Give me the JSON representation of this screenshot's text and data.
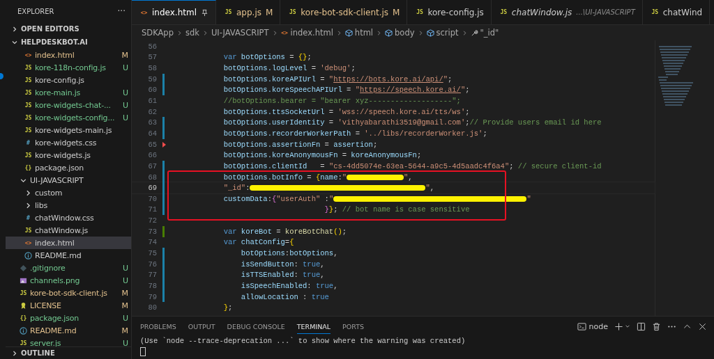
{
  "sidebar": {
    "title": "EXPLORER",
    "more": "···",
    "sections": [
      {
        "label": "OPEN EDITORS",
        "expanded": false
      },
      {
        "label": "HELPDESKBOT.AI",
        "expanded": true
      }
    ],
    "tree": [
      {
        "kind": "scrolled",
        "children": [
          {
            "label": "index.html",
            "kind": "html",
            "icon": "<>",
            "status": "M",
            "selected": false
          },
          {
            "label": "kore-118n-config.js",
            "kind": "js",
            "icon": "JS",
            "status": "U",
            "selected": false
          },
          {
            "label": "kore-config.js",
            "kind": "js",
            "icon": "JS",
            "selected": false
          },
          {
            "label": "kore-main.js",
            "kind": "js",
            "icon": "JS",
            "status": "U",
            "selected": false
          },
          {
            "label": "kore-widgets-chat-...",
            "kind": "js",
            "icon": "JS",
            "status": "U",
            "selected": false
          },
          {
            "label": "kore-widgets-config...",
            "kind": "js",
            "icon": "JS",
            "status": "U",
            "selected": false
          },
          {
            "label": "kore-widgets-main.js",
            "kind": "js",
            "icon": "JS",
            "selected": false
          },
          {
            "label": "kore-widgets.css",
            "kind": "css",
            "icon": "#",
            "selected": false
          },
          {
            "label": "kore-widgets.js",
            "kind": "js",
            "icon": "JS",
            "selected": false
          },
          {
            "label": "package.json",
            "kind": "json",
            "icon": "{}",
            "selected": false
          }
        ]
      },
      {
        "label": "UI-JAVASCRIPT",
        "kind": "folder",
        "expanded": true,
        "selected": false,
        "children": [
          {
            "label": "custom",
            "kind": "folder",
            "expanded": false,
            "selected": false
          },
          {
            "label": "libs",
            "kind": "folder",
            "expanded": false,
            "selected": false
          },
          {
            "label": "chatWindow.css",
            "kind": "css",
            "icon": "#",
            "selected": false
          },
          {
            "label": "chatWindow.js",
            "kind": "js",
            "icon": "JS",
            "selected": false
          },
          {
            "label": "index.html",
            "kind": "html",
            "icon": "<>",
            "selected": true
          },
          {
            "label": "README.md",
            "kind": "info",
            "selected": false
          }
        ]
      },
      {
        "label": ".gitignore",
        "kind": "git",
        "status": "U",
        "selected": false
      },
      {
        "label": "channels.png",
        "kind": "image",
        "status": "U",
        "selected": false
      },
      {
        "label": "kore-bot-sdk-client.js",
        "kind": "js",
        "icon": "JS",
        "status": "M",
        "selected": false
      },
      {
        "label": "LICENSE",
        "kind": "license",
        "status": "M",
        "selected": false
      },
      {
        "label": "package.json",
        "kind": "json",
        "icon": "{}",
        "status": "U",
        "selected": false
      },
      {
        "label": "README.md",
        "kind": "info",
        "status": "M",
        "selected": false
      },
      {
        "label": "server.js",
        "kind": "js",
        "icon": "JS",
        "status": "U",
        "selected": false
      }
    ],
    "outline": {
      "label": "OUTLINE",
      "expanded": false
    }
  },
  "tabs": [
    {
      "label": "index.html",
      "icon": "<>",
      "kind": "html",
      "selected": true,
      "pinned": true,
      "preview": false
    },
    {
      "label": "app.js",
      "icon": "JS",
      "kind": "js",
      "status": "M",
      "selected": false,
      "pinned": false,
      "preview": false
    },
    {
      "label": "kore-bot-sdk-client.js",
      "icon": "JS",
      "kind": "js",
      "status": "M",
      "selected": false,
      "pinned": false,
      "preview": false
    },
    {
      "label": "kore-config.js",
      "icon": "JS",
      "kind": "js",
      "selected": false,
      "pinned": false,
      "preview": false
    },
    {
      "label": "chatWindow.js",
      "icon": "JS",
      "kind": "js",
      "preview": true,
      "path": "...\\UI-JAVASCRIPT",
      "selected": false,
      "pinned": false
    },
    {
      "label": "chatWind",
      "icon": "JS",
      "kind": "js",
      "selected": false,
      "pinned": false,
      "preview": false
    }
  ],
  "breadcrumb": [
    {
      "label": "SDKApp",
      "kind": "folder"
    },
    {
      "label": "sdk",
      "kind": "folder"
    },
    {
      "label": "UI-JAVASCRIPT",
      "kind": "folder"
    },
    {
      "label": "index.html",
      "kind": "html",
      "icon": "<>"
    },
    {
      "label": "html",
      "kind": "element"
    },
    {
      "label": "body",
      "kind": "element"
    },
    {
      "label": "script",
      "kind": "element"
    },
    {
      "label": "\"_id\"",
      "kind": "property"
    }
  ],
  "code": {
    "lines": [
      {
        "number": "56",
        "active": false
      },
      {
        "number": "57",
        "active": false,
        "tokens": [
          {
            "kind": "kw",
            "text": "            var "
          },
          {
            "kind": "var",
            "text": "botOptions"
          },
          {
            "kind": "punc",
            "text": " = "
          },
          {
            "kind": "brace",
            "text": "{}"
          },
          {
            "kind": "punc",
            "text": ";"
          }
        ]
      },
      {
        "number": "58",
        "active": false,
        "tokens": [
          {
            "kind": "var",
            "text": "            botOptions.logLevel"
          },
          {
            "kind": "punc",
            "text": " = "
          },
          {
            "kind": "str",
            "text": "'debug'"
          },
          {
            "kind": "punc",
            "text": ";"
          }
        ]
      },
      {
        "number": "59",
        "active": false,
        "change": {
          "kind": "bar",
          "color": "#1b81a8"
        },
        "tokens": [
          {
            "kind": "var",
            "text": "            botOptions.koreAPIUrl"
          },
          {
            "kind": "punc",
            "text": " = "
          },
          {
            "kind": "str",
            "text": "\""
          },
          {
            "kind": "url",
            "text": "https://bots.kore.ai/api/"
          },
          {
            "kind": "str",
            "text": "\""
          },
          {
            "kind": "punc",
            "text": ";"
          }
        ]
      },
      {
        "number": "60",
        "active": false,
        "change": {
          "kind": "bar",
          "color": "#1b81a8"
        },
        "tokens": [
          {
            "kind": "var",
            "text": "            botOptions.koreSpeechAPIUrl"
          },
          {
            "kind": "punc",
            "text": " = "
          },
          {
            "kind": "str",
            "text": "\""
          },
          {
            "kind": "url",
            "text": "https://speech.kore.ai/"
          },
          {
            "kind": "str",
            "text": "\""
          },
          {
            "kind": "punc",
            "text": ";"
          }
        ]
      },
      {
        "number": "61",
        "active": false,
        "tokens": [
          {
            "kind": "comment",
            "text": "            //botOptions.bearer = \"bearer xyz-------------------\";"
          }
        ]
      },
      {
        "number": "62",
        "active": false,
        "tokens": [
          {
            "kind": "var",
            "text": "            botOptions.ttsSocketUrl"
          },
          {
            "kind": "punc",
            "text": " = "
          },
          {
            "kind": "str",
            "text": "'wss://speech.kore.ai/tts/ws'"
          },
          {
            "kind": "punc",
            "text": ";"
          }
        ]
      },
      {
        "number": "63",
        "active": false,
        "change": {
          "kind": "bar",
          "color": "#1b81a8"
        },
        "tokens": [
          {
            "kind": "var",
            "text": "            botOptions.userIdentity"
          },
          {
            "kind": "punc",
            "text": " = "
          },
          {
            "kind": "str",
            "text": "'vithyabarathi3519@gmail.com'"
          },
          {
            "kind": "punc",
            "text": ";"
          },
          {
            "kind": "comment",
            "text": "// Provide users email id here"
          }
        ]
      },
      {
        "number": "64",
        "active": false,
        "change": {
          "kind": "bar",
          "color": "#1b81a8"
        },
        "tokens": [
          {
            "kind": "var",
            "text": "            botOptions.recorderWorkerPath"
          },
          {
            "kind": "punc",
            "text": " = "
          },
          {
            "kind": "str",
            "text": "'../libs/recorderWorker.js'"
          },
          {
            "kind": "punc",
            "text": ";"
          }
        ]
      },
      {
        "number": "65",
        "active": false,
        "change": {
          "kind": "triangle",
          "color": "#f14c4c"
        },
        "tokens": [
          {
            "kind": "var",
            "text": "            botOptions.assertionFn"
          },
          {
            "kind": "punc",
            "text": " = "
          },
          {
            "kind": "var",
            "text": "assertion"
          },
          {
            "kind": "punc",
            "text": ";"
          }
        ]
      },
      {
        "number": "66",
        "active": false,
        "tokens": [
          {
            "kind": "var",
            "text": "            botOptions.koreAnonymousFn"
          },
          {
            "kind": "punc",
            "text": " = "
          },
          {
            "kind": "var",
            "text": "koreAnonymousFn"
          },
          {
            "kind": "punc",
            "text": ";"
          }
        ]
      },
      {
        "number": "67",
        "active": false,
        "change": {
          "kind": "bar",
          "color": "#1b81a8"
        },
        "tokens": [
          {
            "kind": "var",
            "text": "            botOptions.clientId"
          },
          {
            "kind": "punc",
            "text": "   = "
          },
          {
            "kind": "str",
            "text": "\"cs-4dd5074e-63ea-5644-a9c5-4d5aadc4f6a4\""
          },
          {
            "kind": "punc",
            "text": "; "
          },
          {
            "kind": "comment",
            "text": "// secure client-id"
          }
        ]
      },
      {
        "number": "68",
        "active": false,
        "change": {
          "kind": "bar",
          "color": "#1b81a8"
        },
        "tokens": [
          {
            "kind": "var",
            "text": "            botOptions.botInfo"
          },
          {
            "kind": "punc",
            "text": " = "
          },
          {
            "kind": "brace",
            "text": "{"
          },
          {
            "kind": "var",
            "text": "name"
          },
          {
            "kind": "punc",
            "text": ":"
          },
          {
            "kind": "str",
            "text": "\""
          },
          {
            "kind": "redacted"
          },
          {
            "kind": "str",
            "text": "\""
          },
          {
            "kind": "punc",
            "text": ","
          }
        ]
      },
      {
        "number": "69",
        "active": true,
        "change": {
          "kind": "bar",
          "color": "#1b81a8"
        },
        "tokens": [
          {
            "kind": "str",
            "text": "            \"_id\""
          },
          {
            "kind": "punc",
            "text": ":"
          },
          {
            "kind": "redacted"
          },
          {
            "kind": "str",
            "text": "\""
          },
          {
            "kind": "punc",
            "text": ","
          }
        ]
      },
      {
        "number": "70",
        "active": false,
        "change": {
          "kind": "bar",
          "color": "#1b81a8"
        },
        "tokens": [
          {
            "kind": "var",
            "text": "            customData"
          },
          {
            "kind": "punc",
            "text": ":"
          },
          {
            "kind": "brace2",
            "text": "{"
          },
          {
            "kind": "str",
            "text": "\"userAuth\""
          },
          {
            "kind": "punc",
            "text": " :"
          },
          {
            "kind": "str",
            "text": "\""
          },
          {
            "kind": "redacted"
          },
          {
            "kind": "str",
            "text": "\""
          }
        ]
      },
      {
        "number": "71",
        "active": false,
        "change": {
          "kind": "bar",
          "color": "#1b81a8"
        },
        "tokens": [
          {
            "kind": "brace2",
            "text": "                                   }"
          },
          {
            "kind": "brace",
            "text": "}"
          },
          {
            "kind": "punc",
            "text": "; "
          },
          {
            "kind": "comment",
            "text": "// bot name is case sensitive"
          }
        ]
      },
      {
        "number": "72",
        "active": false
      },
      {
        "number": "73",
        "active": false,
        "change": {
          "kind": "bar",
          "color": "#487e02"
        },
        "tokens": [
          {
            "kind": "kw",
            "text": "            var "
          },
          {
            "kind": "var",
            "text": "koreBot"
          },
          {
            "kind": "punc",
            "text": " = "
          },
          {
            "kind": "fn",
            "text": "koreBotChat"
          },
          {
            "kind": "brace",
            "text": "()"
          },
          {
            "kind": "punc",
            "text": ";"
          }
        ]
      },
      {
        "number": "74",
        "active": false,
        "tokens": [
          {
            "kind": "kw",
            "text": "            var "
          },
          {
            "kind": "var",
            "text": "chatConfig"
          },
          {
            "kind": "punc",
            "text": "="
          },
          {
            "kind": "brace",
            "text": "{"
          }
        ]
      },
      {
        "number": "75",
        "active": false,
        "change": {
          "kind": "bar",
          "color": "#1b81a8"
        },
        "tokens": [
          {
            "kind": "var",
            "text": "                botOptions"
          },
          {
            "kind": "punc",
            "text": ":"
          },
          {
            "kind": "var",
            "text": "botOptions"
          },
          {
            "kind": "punc",
            "text": ","
          }
        ]
      },
      {
        "number": "76",
        "active": false,
        "change": {
          "kind": "bar",
          "color": "#1b81a8"
        },
        "tokens": [
          {
            "kind": "var",
            "text": "                isSendButton"
          },
          {
            "kind": "punc",
            "text": ": "
          },
          {
            "kind": "kw",
            "text": "true"
          },
          {
            "kind": "punc",
            "text": ","
          }
        ]
      },
      {
        "number": "77",
        "active": false,
        "change": {
          "kind": "bar",
          "color": "#1b81a8"
        },
        "tokens": [
          {
            "kind": "var",
            "text": "                isTTSEnabled"
          },
          {
            "kind": "punc",
            "text": ": "
          },
          {
            "kind": "kw",
            "text": "true"
          },
          {
            "kind": "punc",
            "text": ","
          }
        ]
      },
      {
        "number": "78",
        "active": false,
        "change": {
          "kind": "bar",
          "color": "#1b81a8"
        },
        "tokens": [
          {
            "kind": "var",
            "text": "                isSpeechEnabled"
          },
          {
            "kind": "punc",
            "text": ": "
          },
          {
            "kind": "kw",
            "text": "true"
          },
          {
            "kind": "punc",
            "text": ","
          }
        ]
      },
      {
        "number": "79",
        "active": false,
        "change": {
          "kind": "bar",
          "color": "#1b81a8"
        },
        "tokens": [
          {
            "kind": "var",
            "text": "                allowLocation"
          },
          {
            "kind": "punc",
            "text": " : "
          },
          {
            "kind": "kw",
            "text": "true"
          }
        ]
      },
      {
        "number": "80",
        "active": false,
        "tokens": [
          {
            "kind": "brace",
            "text": "            }"
          },
          {
            "kind": "punc",
            "text": ";"
          }
        ]
      }
    ]
  },
  "panel": {
    "tabs": [
      {
        "label": "PROBLEMS",
        "selected": false
      },
      {
        "label": "OUTPUT",
        "selected": false
      },
      {
        "label": "DEBUG CONSOLE",
        "selected": false
      },
      {
        "label": "TERMINAL",
        "selected": true
      },
      {
        "label": "PORTS",
        "selected": false
      }
    ],
    "terminal_name": "node",
    "terminal_lines": [
      "(Use `node --trace-deprecation ...` to show where the warning was created)"
    ]
  }
}
